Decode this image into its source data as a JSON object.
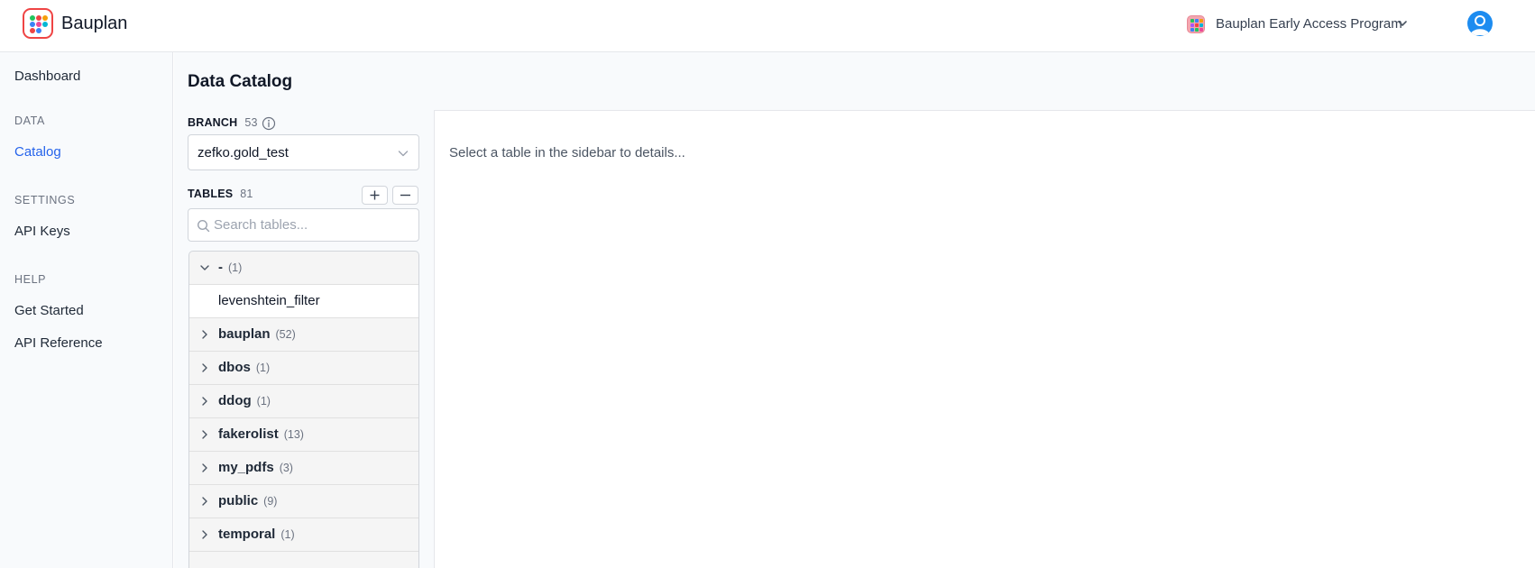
{
  "app": {
    "name": "Bauplan"
  },
  "header": {
    "org_name": "Bauplan Early Access Program",
    "icons": {
      "org": "org-grid-icon",
      "chevron": "chevron-down-icon",
      "avatar": "user-avatar-icon"
    }
  },
  "sidebar": {
    "items": [
      {
        "label": "Dashboard"
      },
      {
        "section": "DATA"
      },
      {
        "label": "Catalog",
        "active": true
      },
      {
        "section": "SETTINGS"
      },
      {
        "label": "API Keys"
      },
      {
        "section": "HELP"
      },
      {
        "label": "Get Started"
      },
      {
        "label": "API Reference"
      }
    ]
  },
  "main": {
    "title": "Data Catalog",
    "branch": {
      "label": "BRANCH",
      "count": "53",
      "selected": "zefko.gold_test"
    },
    "tables": {
      "label": "TABLES",
      "count": "81",
      "search_placeholder": "Search tables..."
    },
    "tree": [
      {
        "name": "-",
        "count": "(1)",
        "expanded": true,
        "children": [
          "levenshtein_filter"
        ]
      },
      {
        "name": "bauplan",
        "count": "(52)"
      },
      {
        "name": "dbos",
        "count": "(1)"
      },
      {
        "name": "ddog",
        "count": "(1)"
      },
      {
        "name": "fakerolist",
        "count": "(13)"
      },
      {
        "name": "my_pdfs",
        "count": "(3)"
      },
      {
        "name": "public",
        "count": "(9)"
      },
      {
        "name": "temporal",
        "count": "(1)"
      }
    ],
    "details_message": "Select a table in the sidebar to details..."
  },
  "colors": {
    "accent": "#2563eb",
    "logo_border": "#ef4444",
    "avatar": "#1d8cf0"
  }
}
